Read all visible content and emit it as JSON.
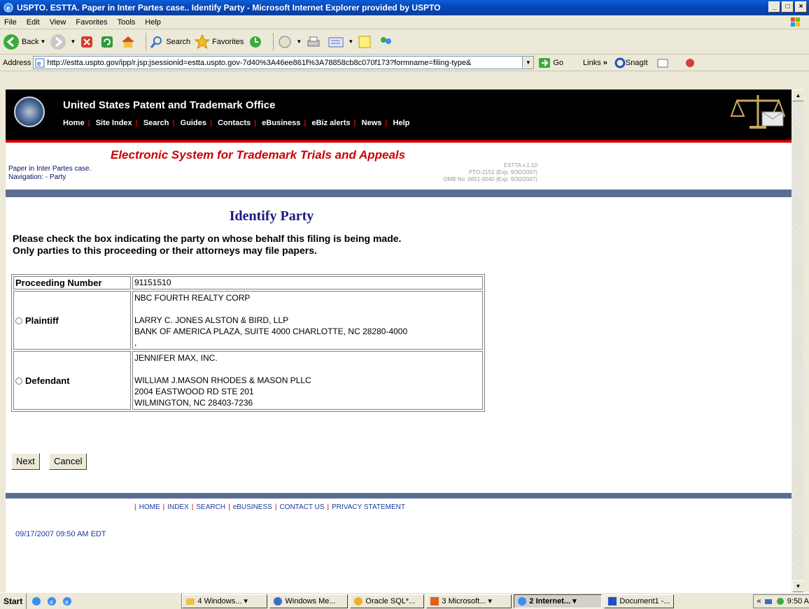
{
  "window": {
    "title": "USPTO. ESTTA. Paper in Inter Partes case.. Identify Party - Microsoft Internet Explorer provided by USPTO"
  },
  "menu": [
    "File",
    "Edit",
    "View",
    "Favorites",
    "Tools",
    "Help"
  ],
  "toolbar": {
    "back": "Back",
    "search": "Search",
    "favorites": "Favorites"
  },
  "address": {
    "label": "Address",
    "url": "http://estta.uspto.gov/ipp/r.jsp;jsessionid=estta.uspto.gov-7d40%3A46ee861f%3A78858cb8c070f173?formname=filing-type&",
    "go": "Go",
    "links": "Links",
    "snagit": "SnagIt"
  },
  "site": {
    "title": "United States Patent and Trademark Office",
    "nav": [
      "Home",
      "Site Index",
      "Search",
      "Guides",
      "Contacts",
      "eBusiness",
      "eBiz alerts",
      "News",
      "Help"
    ]
  },
  "estta": {
    "title": "Electronic System for Trademark Trials and Appeals",
    "case_line": "Paper in Inter Partes case.",
    "nav_line": "Navigation: - Party",
    "version": "ESTTA v.1.10",
    "pto": "PTO-2151 (Exp. 9/30/2007)",
    "omb": "OMB No. 0651-0040 (Exp. 9/30/2007)"
  },
  "page": {
    "heading": "Identify Party",
    "instruction_1": "Please check the box indicating the party on whose behalf this filing is being made.",
    "instruction_2": "Only parties to this proceeding or their attorneys may file papers."
  },
  "table": {
    "proceeding_label": "Proceeding Number",
    "proceeding_number": "91151510",
    "plaintiff": {
      "label": "Plaintiff",
      "name": "NBC FOURTH REALTY CORP",
      "attorney": "LARRY C. JONES ALSTON & BIRD, LLP",
      "address1": "BANK OF AMERICA PLAZA, SUITE 4000 CHARLOTTE, NC 28280-4000",
      "address2": ","
    },
    "defendant": {
      "label": "Defendant",
      "name": "JENNIFER MAX, INC.",
      "attorney": "WILLIAM J.MASON RHODES & MASON PLLC",
      "address1": "2004 EASTWOOD RD STE 201",
      "address2": "WILMINGTON, NC 28403-7236"
    }
  },
  "buttons": {
    "next": "Next",
    "cancel": "Cancel"
  },
  "footer": {
    "links": [
      "HOME",
      "INDEX",
      "SEARCH",
      "eBUSINESS",
      "CONTACT US",
      "PRIVACY STATEMENT"
    ],
    "timestamp": "09/17/2007 09:50 AM EDT"
  },
  "taskbar": {
    "start": "Start",
    "tasks": [
      "4 Windows...",
      "Windows Me...",
      "Oracle SQL*...",
      "3 Microsoft...",
      "2 Internet...",
      "Document1 -..."
    ],
    "clock": "9:50 A"
  }
}
